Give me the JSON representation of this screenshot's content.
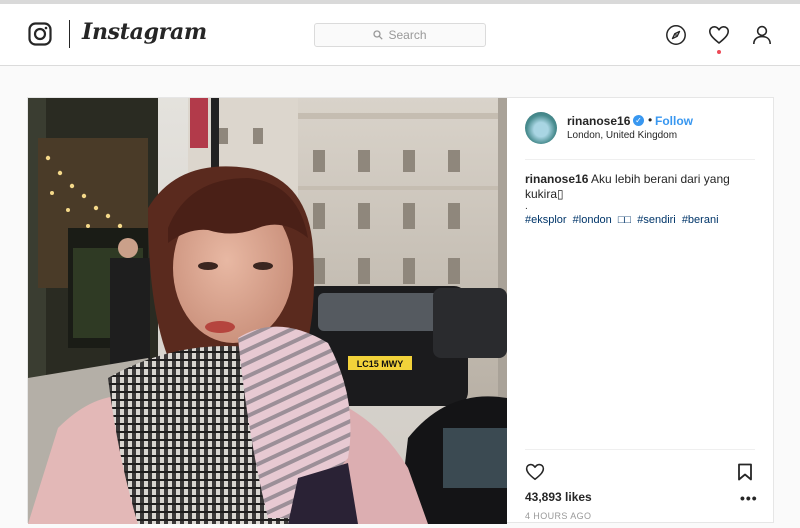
{
  "nav": {
    "brand": "Instagram",
    "search_placeholder": "Search"
  },
  "post": {
    "username": "rinanose16",
    "follow_label": "Follow",
    "location": "London, United Kingdom",
    "caption_user": "rinanose16",
    "caption_text": "Aku lebih berani dari yang kukira",
    "caption_dot": ".",
    "hashtags": [
      "#eksplor",
      "#london",
      "□□",
      "#sendiri",
      "#berani"
    ],
    "likes": "43,893 likes",
    "time_ago": "4 HOURS AGO",
    "license_plate": "LC15 MWY"
  },
  "icons": {
    "logo": "camera-icon",
    "search": "search-icon",
    "explore": "compass-icon",
    "activity": "heart-icon",
    "profile": "person-icon",
    "verified": "verified-badge-icon",
    "like": "heart-outline-icon",
    "save": "bookmark-icon",
    "more": "more-options-icon"
  },
  "colors": {
    "link": "#3897f0",
    "hashtag": "#003569",
    "notification": "#ed4956"
  }
}
